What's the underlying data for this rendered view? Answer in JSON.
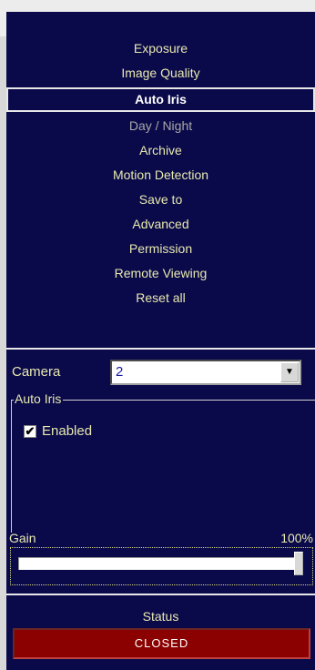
{
  "window": {
    "close_glyph": "×"
  },
  "menu": {
    "items": [
      {
        "label": "Exposure",
        "state": "normal"
      },
      {
        "label": "Image Quality",
        "state": "normal"
      },
      {
        "label": "Auto Iris",
        "state": "selected"
      },
      {
        "label": "Day / Night",
        "state": "dim"
      },
      {
        "label": "Archive",
        "state": "normal"
      },
      {
        "label": "Motion Detection",
        "state": "normal"
      },
      {
        "label": "Save to",
        "state": "normal"
      },
      {
        "label": "Advanced",
        "state": "normal"
      },
      {
        "label": "Permission",
        "state": "normal"
      },
      {
        "label": "Remote Viewing",
        "state": "normal"
      },
      {
        "label": "Reset all",
        "state": "normal"
      }
    ]
  },
  "camera": {
    "label": "Camera",
    "value": "2",
    "dropdown_icon": "chevron-down-icon"
  },
  "auto_iris": {
    "group_title": "Auto Iris",
    "enabled_label": "Enabled",
    "enabled_checked": true,
    "check_glyph": "✔"
  },
  "gain": {
    "label": "Gain",
    "value_text": "100%",
    "level_fraction": 1.0
  },
  "status": {
    "label": "Status",
    "value": "CLOSED"
  },
  "colors": {
    "background": "#0a0a4a",
    "text": "#e8e8b0",
    "selected_text": "#ffffff",
    "status_bg": "#8b0000"
  }
}
